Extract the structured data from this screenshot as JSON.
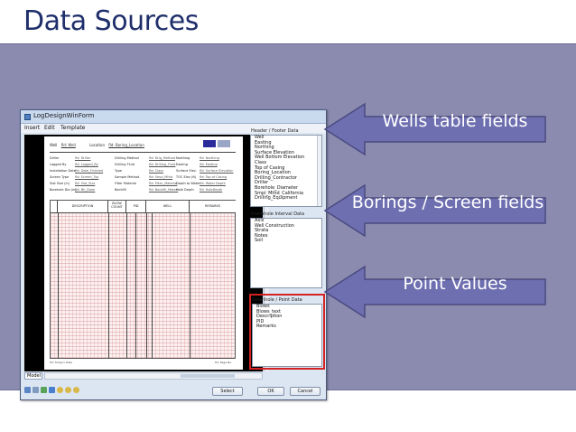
{
  "slide": {
    "title": "Data Sources"
  },
  "window": {
    "title": "LogDesignWinForm",
    "menu": [
      "Insert",
      "Edit",
      "Template"
    ],
    "log_header": {
      "well_label": "Well",
      "well_value": "fld: Well",
      "location_label": "Location",
      "location_value": "fld: Boring_Location",
      "rows": [
        [
          "Driller",
          "fld: Driller",
          "Drilling Method",
          "fld: Drlg_Method",
          "Northing",
          "fld: Northing"
        ],
        [
          "Logged By",
          "fld: Logged_By",
          "Drilling Fluid",
          "fld: Drilling_Fluid",
          "Easting",
          "fld: Easting"
        ],
        [
          "Installation Date",
          "fld: Date_Finished",
          "Type",
          "fld: Class",
          "Surface Elev.",
          "fld: Surface Elevation"
        ],
        [
          "Screen Type",
          "fld: Screen_Typ",
          "Sample Method",
          "fld: Smpl_Mthd",
          "TOC Elev (ft)",
          "fld: Top of Casing"
        ],
        [
          "Slot Size (in)",
          "fld: Slot_Size",
          "Filter Material",
          "fld: Filter_Material",
          "Depth to Water",
          "fld: Water Depth"
        ],
        [
          "Borehole Dia (in)",
          "fld: Bh_Diam",
          "Backfill",
          "fld: Backfill_Materl",
          "Hole Depth",
          "fld: HoleDepth"
        ]
      ],
      "columns": [
        "DESCRIPTION",
        "BLOW COUNT",
        "PID",
        "WELL",
        "REMARKS"
      ],
      "footer_left": "fld: Today's Date",
      "footer_right": "fld: Page No."
    },
    "model_tab": "Model",
    "buttons": {
      "select": "Select",
      "ok": "OK",
      "cancel": "Cancel"
    },
    "header_footer": {
      "label": "Header / Footer Data",
      "items": [
        "Well",
        "Easting",
        "Northing",
        "Surface Elevation",
        "Well Bottom Elevation",
        "Class",
        "Top of Casing",
        "Boring_Location",
        "Drilling_Contractor",
        "Driller",
        "Borehole_Diameter",
        "Smpl_Mthd_California",
        "Drilling_Equipment"
      ]
    },
    "interval": {
      "label": "Downhole Interval Data",
      "items": [
        "Axis",
        "Well Construction",
        "Strata",
        "Notes",
        "Soil"
      ]
    },
    "point": {
      "label": "Downhole / Point Data",
      "items": [
        "Blows",
        "Blows_text",
        "Description",
        "PID",
        "Remarks"
      ]
    }
  },
  "callouts": {
    "wells": "Wells table fields",
    "borings": "Borings / Screen fields",
    "point": "Point Values"
  },
  "colors": {
    "band": "#8b8bb0",
    "callout_fill": "#6e6fb0",
    "callout_stroke": "#4a4a80",
    "highlight": "#d22222",
    "title": "#1f2f6b"
  }
}
